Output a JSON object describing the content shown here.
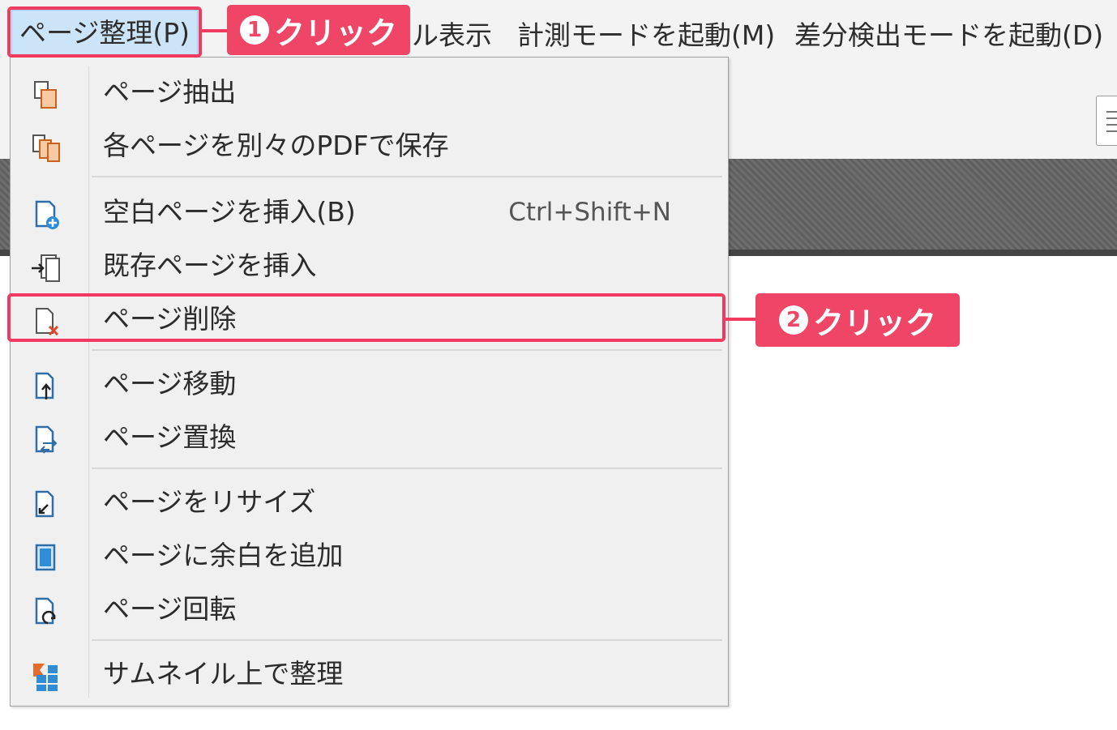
{
  "menubar": {
    "items": [
      {
        "label": "ページ整理(P)"
      },
      {
        "label": "ル表示"
      },
      {
        "label": "計測モードを起動(M)"
      },
      {
        "label": "差分検出モードを起動(D)"
      }
    ]
  },
  "dropdown": {
    "items": [
      {
        "label": "ページ抽出",
        "icon": "page-extract-icon"
      },
      {
        "label": "各ページを別々のPDFで保存",
        "icon": "split-pages-icon"
      },
      {
        "label": "空白ページを挿入(B)",
        "shortcut": "Ctrl+Shift+N",
        "icon": "blank-page-insert-icon"
      },
      {
        "label": "既存ページを挿入",
        "icon": "insert-existing-page-icon"
      },
      {
        "label": "ページ削除",
        "icon": "page-delete-icon"
      },
      {
        "label": "ページ移動",
        "icon": "page-move-icon"
      },
      {
        "label": "ページ置換",
        "icon": "page-replace-icon"
      },
      {
        "label": "ページをリサイズ",
        "icon": "page-resize-icon"
      },
      {
        "label": "ページに余白を追加",
        "icon": "add-margin-icon"
      },
      {
        "label": "ページ回転",
        "icon": "page-rotate-icon"
      },
      {
        "label": "サムネイル上で整理",
        "icon": "thumbnail-organize-icon"
      }
    ]
  },
  "annotations": {
    "step1": {
      "number": "1",
      "text": "クリック"
    },
    "step2": {
      "number": "2",
      "text": "クリック"
    }
  },
  "colors": {
    "accent": "#ef4566",
    "menu_active_bg": "#cce4f7",
    "menu_bg": "#f0f0f0"
  }
}
